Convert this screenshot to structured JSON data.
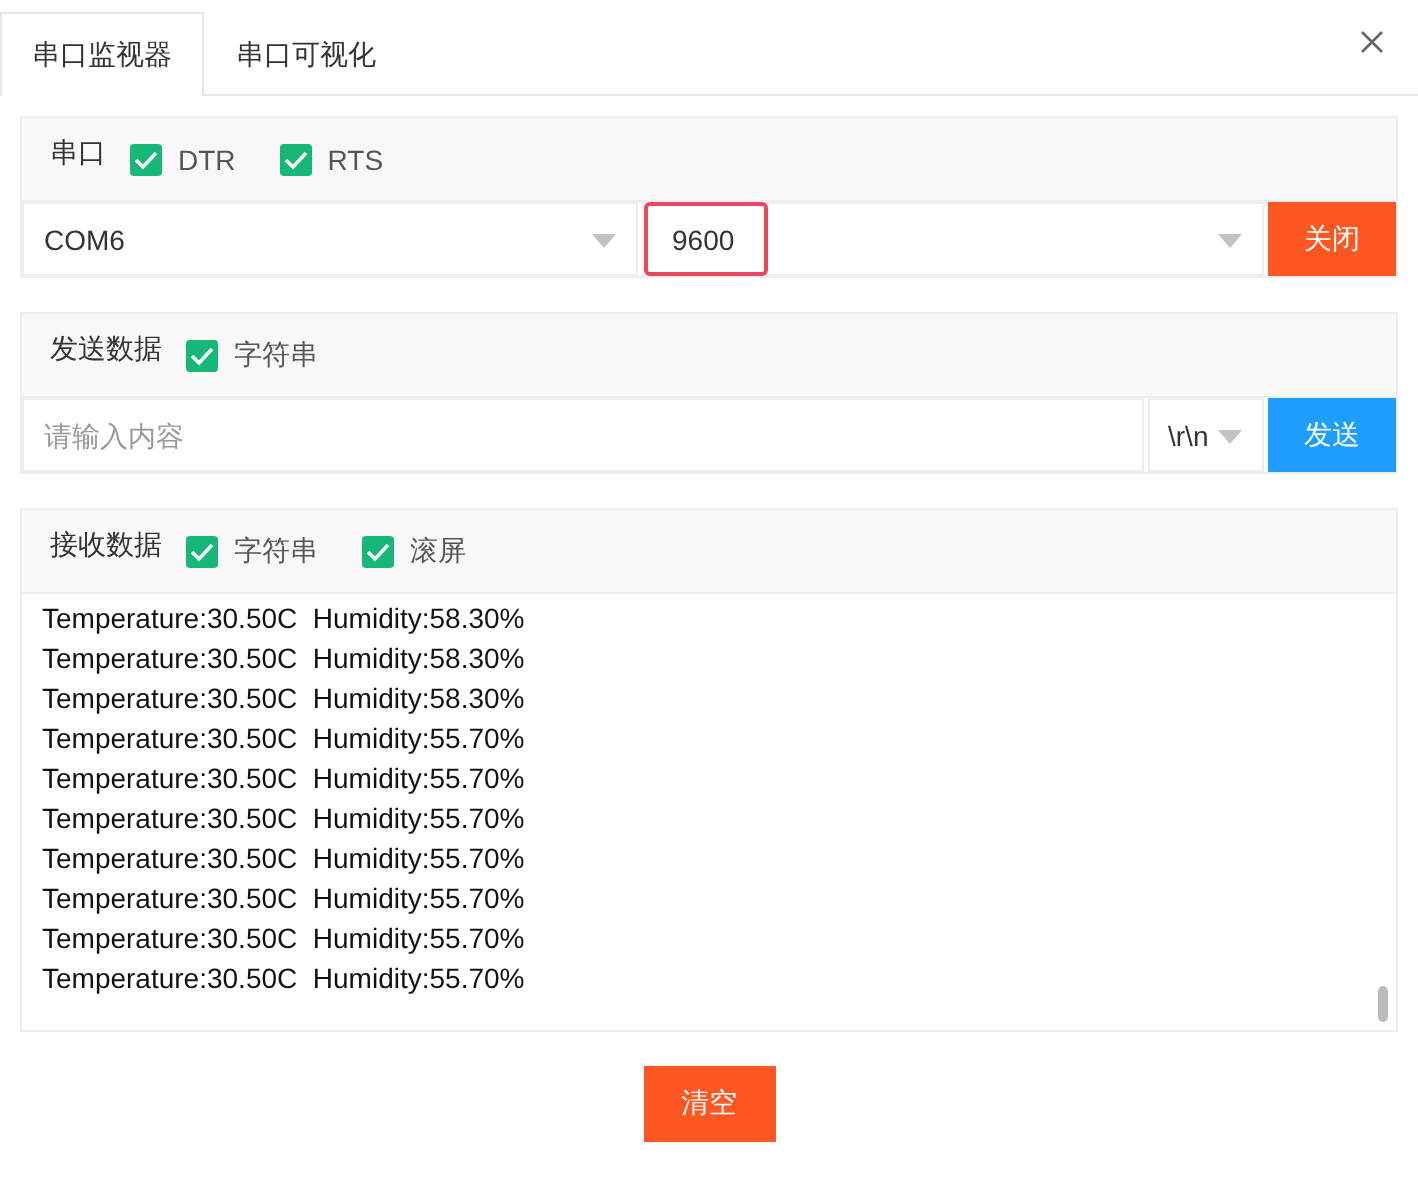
{
  "tabs": [
    {
      "label": "串口监视器",
      "selected": true
    },
    {
      "label": "串口可视化",
      "selected": false
    }
  ],
  "serial": {
    "label": "串口",
    "options": [
      {
        "label": "DTR",
        "checked": true
      },
      {
        "label": "RTS",
        "checked": true
      }
    ],
    "port": "COM6",
    "baud": "9600",
    "baud_focused": true,
    "button": "关闭"
  },
  "send": {
    "label": "发送数据",
    "options": [
      {
        "label": "字符串",
        "checked": true
      }
    ],
    "placeholder": "请输入内容",
    "line_ending": "\\r\\n",
    "button": "发送"
  },
  "receive": {
    "label": "接收数据",
    "options": [
      {
        "label": "字符串",
        "checked": true
      },
      {
        "label": "滚屏",
        "checked": true
      }
    ],
    "lines": [
      "Temperature:30.50C  Humidity:58.30%",
      "Temperature:30.50C  Humidity:58.30%",
      "Temperature:30.50C  Humidity:58.30%",
      "Temperature:30.50C  Humidity:55.70%",
      "Temperature:30.50C  Humidity:55.70%",
      "Temperature:30.50C  Humidity:55.70%",
      "Temperature:30.50C  Humidity:55.70%",
      "Temperature:30.50C  Humidity:55.70%",
      "Temperature:30.50C  Humidity:55.70%",
      "Temperature:30.50C  Humidity:55.70%"
    ]
  },
  "clear_button": "清空"
}
